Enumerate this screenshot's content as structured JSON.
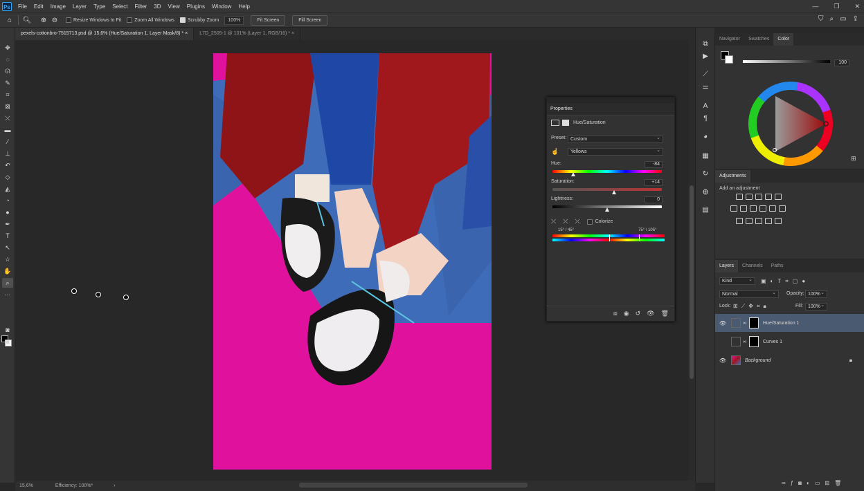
{
  "menubar": {
    "logo": "Ps",
    "items": [
      "File",
      "Edit",
      "Image",
      "Layer",
      "Type",
      "Select",
      "Filter",
      "3D",
      "View",
      "Plugins",
      "Window",
      "Help"
    ],
    "window_controls": [
      "—",
      "❐",
      "✕"
    ]
  },
  "options": {
    "resize_windows": "Resize Windows to Fit",
    "zoom_all": "Zoom All Windows",
    "scrubby": "Scrubby Zoom",
    "zoom_value": "100%",
    "fit_screen": "Fit Screen",
    "fill_screen": "Fill Screen"
  },
  "tabs": [
    {
      "label": "pexels-cottonbro-7515713.psd @ 15,6% (Hue/Saturation 1, Layer Mask/8) *",
      "close": "×"
    },
    {
      "label": "L7D_2505-1 @ 101% (Layer 1, RGB/16) *",
      "close": "×"
    }
  ],
  "status": {
    "zoom": "15,6%",
    "efficiency": "Efficiency: 100%*",
    "arrow": "›"
  },
  "properties": {
    "title": "Properties",
    "adj_name": "Hue/Saturation",
    "preset_label": "Preset:",
    "preset_value": "Custom",
    "channel_value": "Yellows",
    "hue_label": "Hue:",
    "hue_value": "-84",
    "sat_label": "Saturation:",
    "sat_value": "+14",
    "light_label": "Lightness:",
    "light_value": "0",
    "colorize": "Colorize",
    "range_left": "15° / 45°",
    "range_right": "75° \\ 105°"
  },
  "color_panel": {
    "tabs": [
      "Navigator",
      "Swatches",
      "Color"
    ],
    "k_value": "100"
  },
  "adjustments": {
    "title": "Adjustments",
    "add_label": "Add an adjustment"
  },
  "layers": {
    "tabs": [
      "Layers",
      "Channels",
      "Paths"
    ],
    "kind": "Kind",
    "blend": "Normal",
    "opacity_label": "Opacity:",
    "opacity_value": "100%",
    "lock_label": "Lock:",
    "fill_label": "Fill:",
    "fill_value": "100%",
    "items": [
      {
        "name": "Hue/Saturation 1"
      },
      {
        "name": "Curves 1"
      },
      {
        "name": "Background"
      }
    ]
  }
}
